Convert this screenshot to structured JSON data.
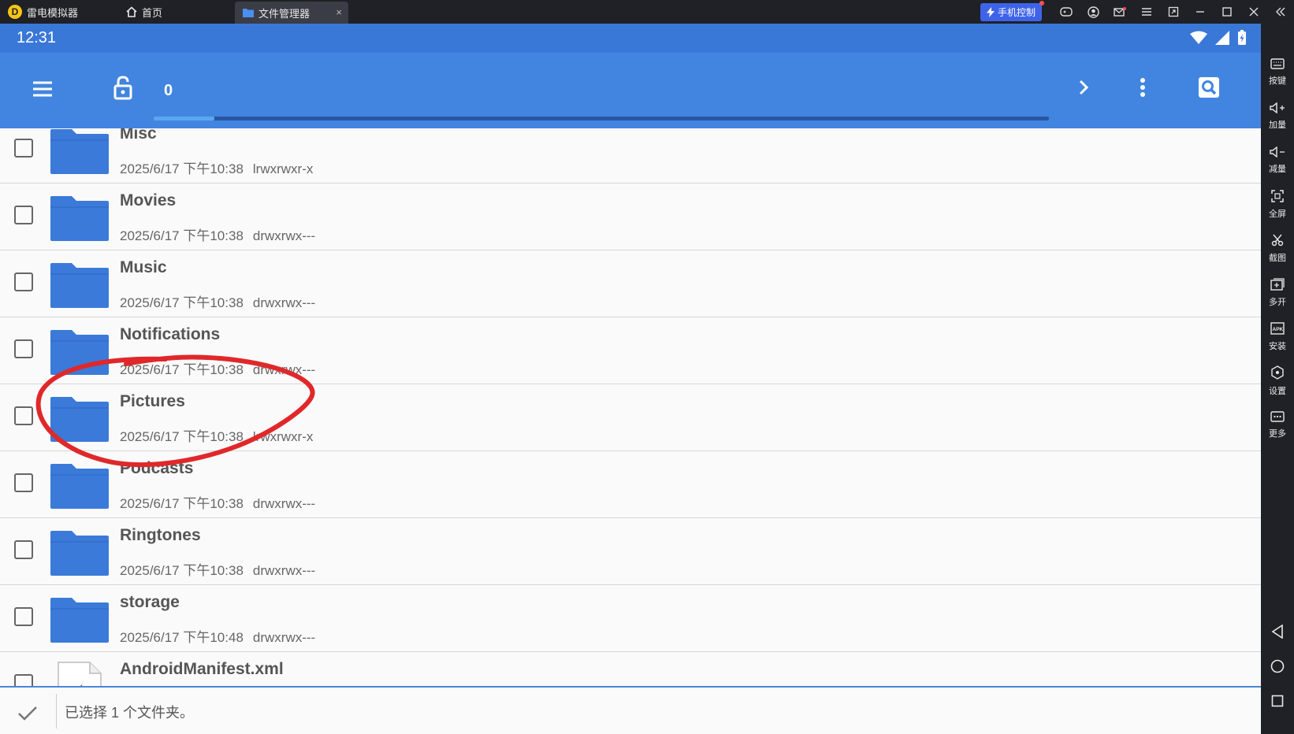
{
  "titlebar": {
    "app_name": "雷电模拟器",
    "tabs": [
      {
        "label": "首页"
      },
      {
        "label": "文件管理器"
      }
    ],
    "close_glyph": "×",
    "phone_control_label": "手机控制"
  },
  "statusbar": {
    "time": "12:31"
  },
  "toolbar": {
    "selected_count": "0",
    "progress_fraction": 0.068
  },
  "files": [
    {
      "name": "Misc",
      "date": "2025/6/17 下午10:38",
      "perms": "lrwxrwxr-x",
      "type": "folder"
    },
    {
      "name": "Movies",
      "date": "2025/6/17 下午10:38",
      "perms": "drwxrwx---",
      "type": "folder"
    },
    {
      "name": "Music",
      "date": "2025/6/17 下午10:38",
      "perms": "drwxrwx---",
      "type": "folder"
    },
    {
      "name": "Notifications",
      "date": "2025/6/17 下午10:38",
      "perms": "drwxrwx---",
      "type": "folder"
    },
    {
      "name": "Pictures",
      "date": "2025/6/17 下午10:38",
      "perms": "lrwxrwxr-x",
      "type": "folder"
    },
    {
      "name": "Podcasts",
      "date": "2025/6/17 下午10:38",
      "perms": "drwxrwx---",
      "type": "folder"
    },
    {
      "name": "Ringtones",
      "date": "2025/6/17 下午10:38",
      "perms": "drwxrwx---",
      "type": "folder"
    },
    {
      "name": "storage",
      "date": "2025/6/17 下午10:48",
      "perms": "drwxrwx---",
      "type": "folder"
    },
    {
      "name": "AndroidManifest.xml",
      "date": "",
      "perms": "",
      "type": "file"
    }
  ],
  "sidebar": {
    "items": [
      {
        "label": "按键",
        "icon": "keyboard-icon"
      },
      {
        "label": "加量",
        "icon": "volume-up-icon"
      },
      {
        "label": "减量",
        "icon": "volume-down-icon"
      },
      {
        "label": "全屏",
        "icon": "fullscreen-icon"
      },
      {
        "label": "截图",
        "icon": "scissors-icon"
      },
      {
        "label": "多开",
        "icon": "multi-instance-icon"
      },
      {
        "label": "安装",
        "icon": "apk-icon"
      },
      {
        "label": "设置",
        "icon": "settings-icon"
      },
      {
        "label": "更多",
        "icon": "more-icon"
      }
    ]
  },
  "bottom": {
    "status_text": "已选择 1 个文件夹。"
  },
  "colors": {
    "toolbar": "#4285e0",
    "statusbar": "#3a78d8",
    "folder": "#3b7ad9",
    "annotation": "#e0282a"
  }
}
